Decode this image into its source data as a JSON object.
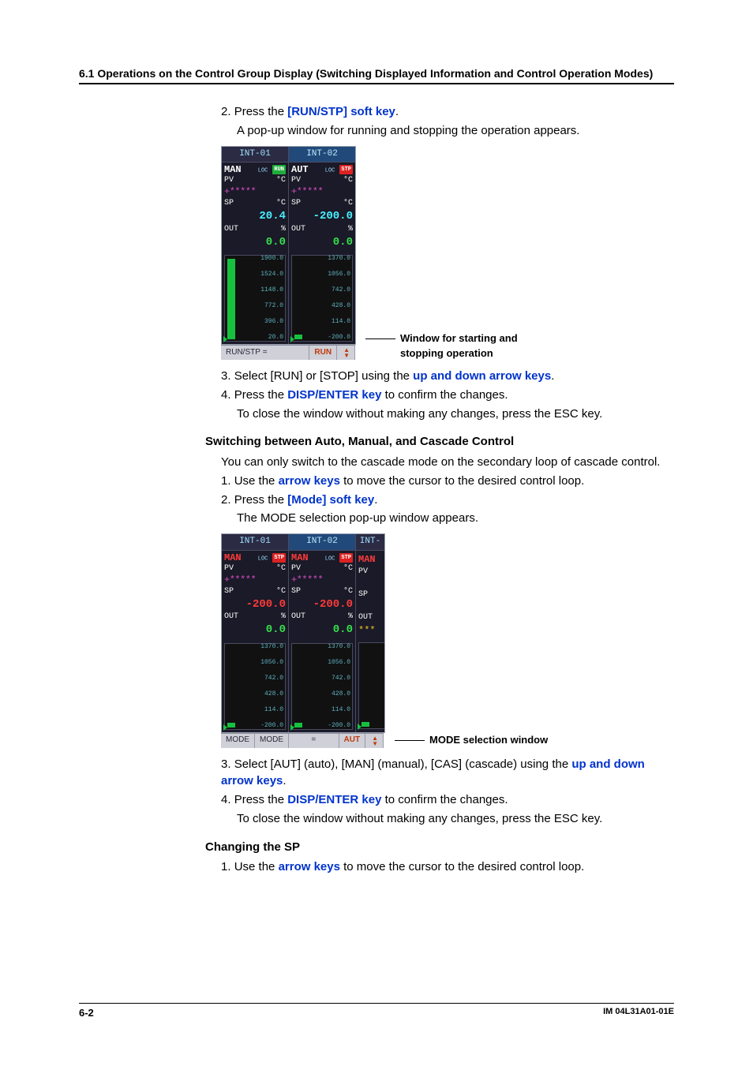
{
  "header": "6.1  Operations on the Control Group Display (Switching Displayed Information and Control Operation Modes)",
  "step2": {
    "num": "2.",
    "pre": "Press the ",
    "key": "[RUN/STP] soft key",
    "post": ".",
    "desc": "A pop-up window for running and stopping the operation appears."
  },
  "shot1": {
    "caption_l1": "Window for starting and",
    "caption_l2": "stopping operation",
    "tab1": "INT-01",
    "tab2": "INT-02",
    "p1": {
      "mode": "MAN",
      "loc": "LOC",
      "badge": "RUN",
      "pv_lbl": "PV",
      "pv_unit": "°C",
      "pv_val": "+*****",
      "sp_lbl": "SP",
      "sp_unit": "°C",
      "sp_val": "20.4",
      "out_lbl": "OUT",
      "out_unit": "%",
      "out_val": "0.0",
      "ticks": [
        "1900.0",
        "1524.0",
        "1148.0",
        "772.0",
        "396.0",
        "20.0"
      ]
    },
    "p2": {
      "mode": "AUT",
      "loc": "LOC",
      "badge": "STP",
      "pv_lbl": "PV",
      "pv_unit": "°C",
      "pv_val": "+*****",
      "sp_lbl": "SP",
      "sp_unit": "°C",
      "sp_val": "-200.0",
      "out_lbl": "OUT",
      "out_unit": "%",
      "out_val": "0.0",
      "ticks": [
        "1370.0",
        "1056.0",
        "742.0",
        "428.0",
        "114.0",
        "-200.0"
      ]
    },
    "soft_l": "RUN/STP",
    "soft_eq": "=",
    "soft_r": "RUN"
  },
  "step3": {
    "num": "3.",
    "pre": "Select [RUN] or [STOP] using the ",
    "key": "up and down arrow keys",
    "post": "."
  },
  "step4": {
    "num": "4.",
    "pre": "Press the ",
    "key": "DISP/ENTER key",
    "post": " to confirm the changes.",
    "note": "To close the window without making any changes, press the ESC key."
  },
  "switch_head": "Switching between Auto, Manual, and Cascade Control",
  "switch_note": "You can only switch to the cascade mode on the secondary loop of cascade control.",
  "switch_s1": {
    "num": "1.",
    "pre": "Use the ",
    "key": "arrow keys",
    "post": " to move the cursor to the desired control loop."
  },
  "switch_s2": {
    "num": "2.",
    "pre": "Press the ",
    "key": "[Mode] soft key",
    "post": ".",
    "desc": "The MODE selection pop-up window appears."
  },
  "shot2": {
    "caption": "MODE selection window",
    "tab1": "INT-01",
    "tab2": "INT-02",
    "tab3": "INT-",
    "p": {
      "mode": "MAN",
      "loc": "LOC",
      "badge": "STP",
      "pv_lbl": "PV",
      "pv_unit": "°C",
      "pv_val": "+*****",
      "sp_lbl": "SP",
      "sp_unit": "°C",
      "sp_val": "-200.0",
      "out_lbl": "OUT",
      "out_unit": "%",
      "out_val": "0.0",
      "ticks": [
        "1370.0",
        "1056.0",
        "742.0",
        "428.0",
        "114.0",
        "-200.0"
      ]
    },
    "p3": {
      "mode": "MAN",
      "pv_lbl": "PV",
      "sp_lbl": "SP",
      "out_lbl": "OUT",
      "out_val": "***"
    },
    "soft_l1": "MODE",
    "soft_l2": "MODE",
    "soft_eq": "=",
    "soft_r": "AUT"
  },
  "switch_s3": {
    "num": "3.",
    "pre": "Select [AUT] (auto), [MAN] (manual), [CAS] (cascade) using the ",
    "key": "up and down arrow keys",
    "post": "."
  },
  "switch_s4": {
    "num": "4.",
    "pre": "Press the ",
    "key": "DISP/ENTER key",
    "post": " to confirm the changes.",
    "note": "To close the window without making any changes, press the ESC key."
  },
  "changing_head": "Changing the SP",
  "changing_s1": {
    "num": "1.",
    "pre": "Use the ",
    "key": "arrow keys",
    "post": " to move the cursor to the desired control loop."
  },
  "footer": {
    "left": "6-2",
    "right": "IM 04L31A01-01E"
  }
}
